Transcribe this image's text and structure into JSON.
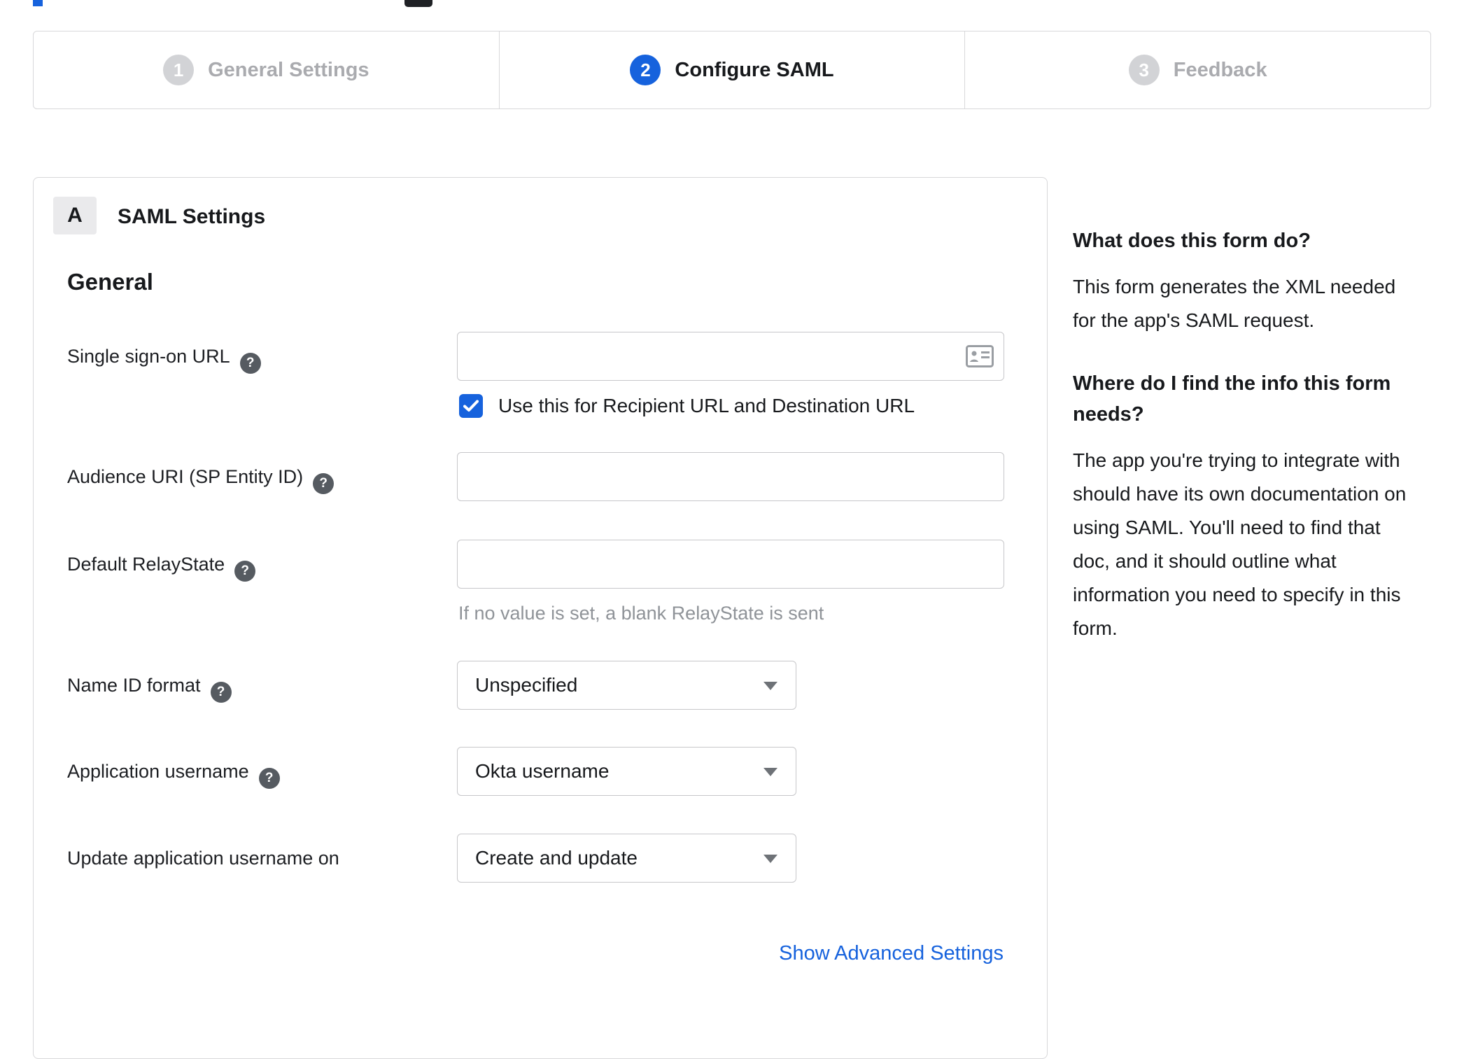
{
  "ui": {
    "help_glyph": "?"
  },
  "stepper": {
    "steps": [
      {
        "number": "1",
        "label": "General Settings",
        "state": "inactive"
      },
      {
        "number": "2",
        "label": "Configure SAML",
        "state": "active"
      },
      {
        "number": "3",
        "label": "Feedback",
        "state": "inactive"
      }
    ]
  },
  "form": {
    "section_badge": "A",
    "section_title": "SAML Settings",
    "group_title": "General",
    "fields": {
      "sso_url": {
        "label": "Single sign-on URL",
        "value": ""
      },
      "sso_checkbox": {
        "label": "Use this for Recipient URL and Destination URL",
        "checked": true
      },
      "audience_uri": {
        "label": "Audience URI (SP Entity ID)",
        "value": ""
      },
      "relay_state": {
        "label": "Default RelayState",
        "value": "",
        "hint": "If no value is set, a blank RelayState is sent"
      },
      "name_id_format": {
        "label": "Name ID format",
        "value": "Unspecified"
      },
      "app_username": {
        "label": "Application username",
        "value": "Okta username"
      },
      "update_app_username": {
        "label": "Update application username on",
        "value": "Create and update"
      }
    },
    "advanced_link": "Show Advanced Settings"
  },
  "sidebar": {
    "sections": [
      {
        "title": "What does this form do?",
        "body": "This form generates the XML needed for the app's SAML request."
      },
      {
        "title": "Where do I find the info this form needs?",
        "body": "The app you're trying to integrate with should have its own documentation on using SAML. You'll need to find that doc, and it should outline what information you need to specify in this form."
      }
    ]
  },
  "colors": {
    "accent_blue": "#1662dd",
    "inactive_gray": "#d2d3d6"
  }
}
